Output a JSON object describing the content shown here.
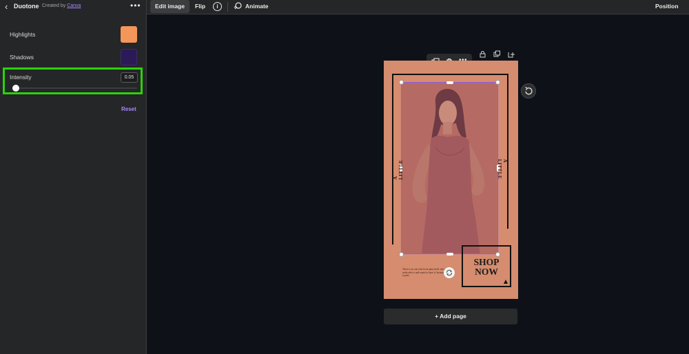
{
  "panel": {
    "title": "Duotone",
    "created_by_prefix": "Created by",
    "created_by_link": "Canva",
    "highlights_label": "Highlights",
    "highlights_color": "#f2965a",
    "shadows_label": "Shadows",
    "shadows_color": "#2b1a57",
    "intensity_label": "Intensity",
    "intensity_value": "0.05",
    "reset_label": "Reset"
  },
  "topbar": {
    "edit_image": "Edit image",
    "flip": "Flip",
    "info": "i",
    "animate": "Animate",
    "position": "Position"
  },
  "canvas": {
    "vertical_text": "A LITTLE",
    "shop_line1": "SHOP",
    "shop_line2": "NOW",
    "small_text": "There is no one who loves pain itself, who seeks after it and wants to have it, because it is pain.",
    "add_page": "+ Add page"
  },
  "colors": {
    "accent": "#a78bfa",
    "highlight_box": "#2bd20b",
    "page_bg": "#d68c6e"
  }
}
